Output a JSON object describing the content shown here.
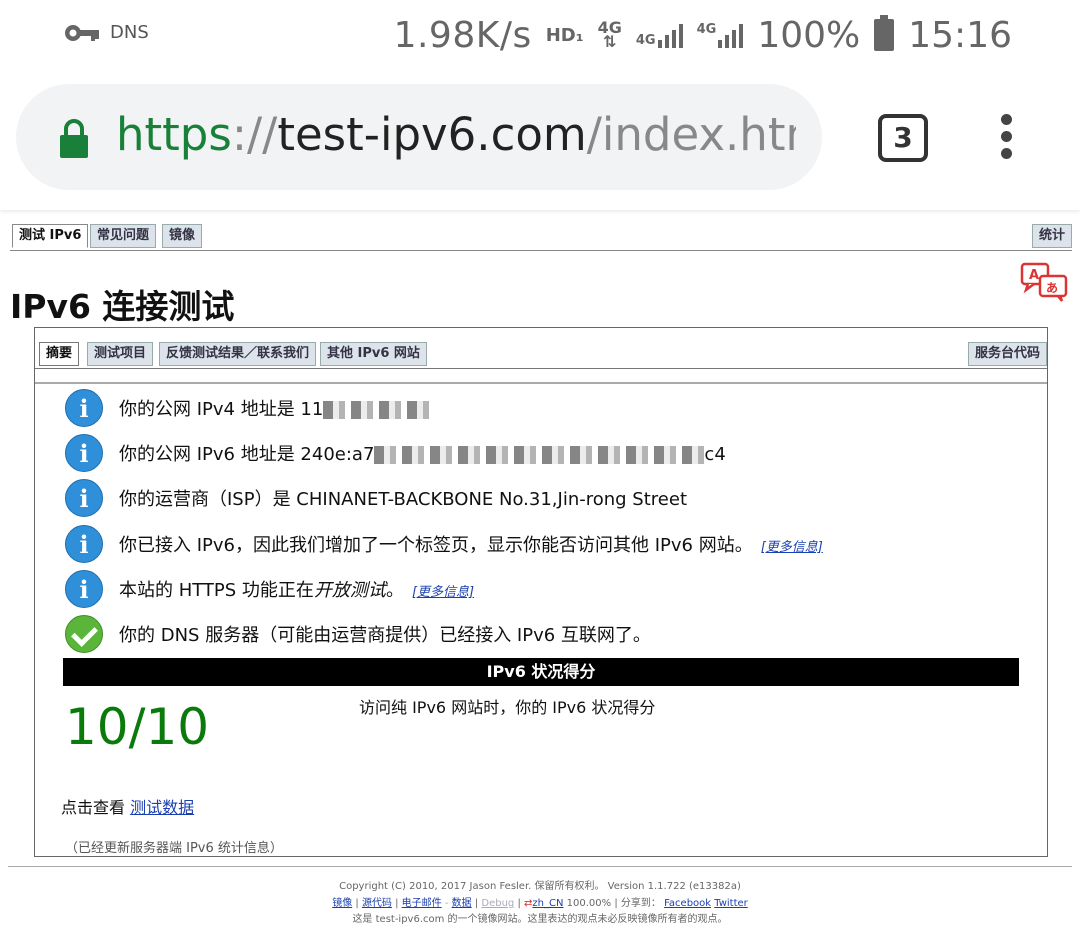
{
  "statusbar": {
    "vpn_label": "DNS",
    "speed": "1.98K/s",
    "hd": "HD₁",
    "net1": "4G",
    "net2": "4G",
    "net3": "4G",
    "battery": "100%",
    "time": "15:16"
  },
  "browser": {
    "url_scheme": "https",
    "url_sep": "://",
    "url_host": "test-ipv6.com",
    "url_path": "/index.html.z",
    "tab_count": "3"
  },
  "topnav": {
    "tabs": [
      "测试 IPv6",
      "常见问题",
      "镜像"
    ],
    "stats": "统计"
  },
  "page": {
    "title": "IPv6 连接测试"
  },
  "subnav": {
    "tabs": [
      "摘要",
      "测试项目",
      "反馈测试结果／联系我们",
      "其他 IPv6 网站"
    ],
    "helpdesk": "服务台代码"
  },
  "results": {
    "ipv4": "你的公网 IPv4 地址是 11",
    "ipv6_prefix": "你的公网 IPv6 地址是 240e:a7",
    "ipv6_suffix": "c4",
    "isp": "你的运营商（ISP）是 CHINANET-BACKBONE No.31,Jin-rong Street",
    "ipv6_tab": "你已接入 IPv6，因此我们增加了一个标签页，显示你能否访问其他 IPv6 网站。",
    "more_info": "[更多信息]",
    "https_pre": "本站的 HTTPS 功能正在",
    "https_ital": "开放测试",
    "https_post": "。",
    "dns": "你的 DNS 服务器（可能由运营商提供）已经接入 IPv6 互联网了。"
  },
  "score": {
    "header": "IPv6 状况得分",
    "value": "10/10",
    "desc": "访问纯 IPv6 网站时，你的 IPv6 状况得分"
  },
  "viewdata": {
    "prefix": "点击查看 ",
    "link": "测试数据"
  },
  "updated": "（已经更新服务器端 IPv6 统计信息）",
  "footer": {
    "line1": "Copyright (C) 2010, 2017 Jason Fesler. 保留所有权利。 Version 1.1.722 (e13382a)",
    "links": [
      "镜像",
      "源代码",
      "电子邮件",
      "-",
      "数据",
      "Debug",
      "zh_CN"
    ],
    "locale_pct": "100.00%",
    "share": "分享到：",
    "facebook": "Facebook",
    "twitter": "Twitter",
    "line3": "这是 test-ipv6.com 的一个镜像网站。这里表达的观点未必反映镜像所有者的观点。"
  },
  "colors": {
    "secure_green": "#188038",
    "score_green": "#0a7a0a",
    "info_blue": "#2f8fd8",
    "ok_green": "#5ab53a",
    "link_blue": "#1a3fb0"
  }
}
